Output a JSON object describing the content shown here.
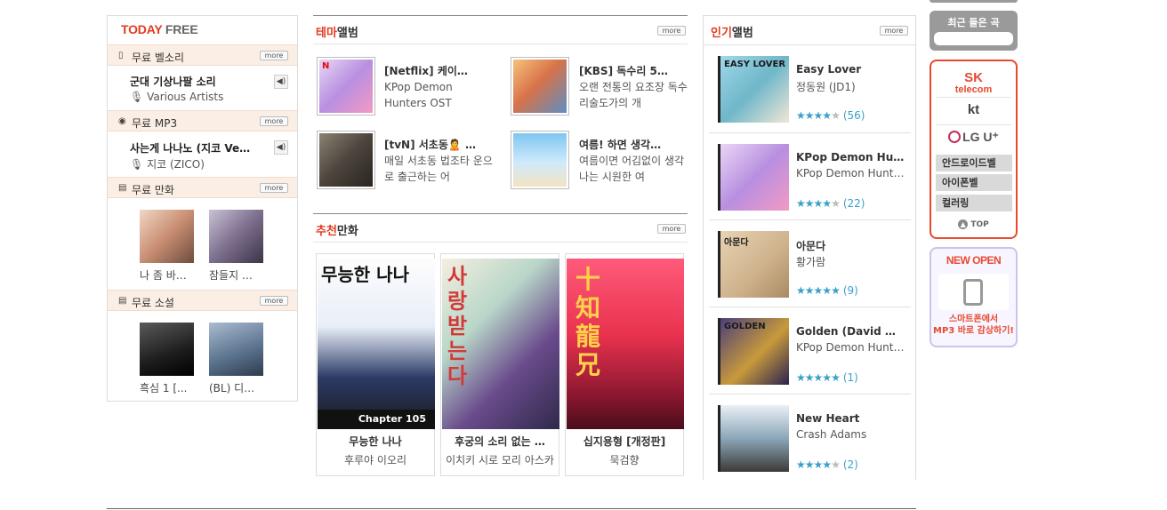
{
  "today_free": {
    "title_red": "TODAY",
    "title_grey": "FREE",
    "more": "more",
    "ringtone": {
      "label": "무료 벨소리",
      "title": "군대 기상나팔 소리",
      "artist": "Various Artists"
    },
    "mp3": {
      "label": "무료 MP3",
      "title": "사는게 나나노 (지코 Ve…",
      "artist": "지코 (ZICO)"
    },
    "comic": {
      "label": "무료 만화",
      "items": [
        {
          "caption": "나 좀 바…"
        },
        {
          "caption": "잠들지 …"
        }
      ]
    },
    "novel": {
      "label": "무료 소설",
      "items": [
        {
          "caption": "흑심 1 [..."
        },
        {
          "caption": "(BL) 디…"
        }
      ]
    }
  },
  "theme_album": {
    "title_red": "테마",
    "title_rest": "앨범",
    "more": "more",
    "items": [
      {
        "title": "[Netflix] 케이…",
        "desc": "KPop Demon Hunters OST"
      },
      {
        "title": "[KBS] 독수리 5…",
        "desc": "오랜 전통의 요조장 독수리술도가의 개"
      },
      {
        "title": "[tvN] 서초동🙎 …",
        "desc": "매일 서초동 법조타 운으로 출근하는 어"
      },
      {
        "title": "여름! 하면 생각…",
        "desc": "여름이면 어김없이 생각나는 시원한 여"
      }
    ]
  },
  "recommended_comic": {
    "title_red": "추천",
    "title_rest": "만화",
    "more": "more",
    "items": [
      {
        "title": "무능한 나나",
        "author": "후루야 이오리",
        "cover_text": "무능한 나나",
        "cover_sub": "Chapter 105"
      },
      {
        "title": "후궁의 소리 없는 …",
        "author": "이치키 시로 모리 아스카",
        "cover_text": "사랑받는다"
      },
      {
        "title": "십지용형 [개정판]",
        "author": "묵검향",
        "cover_text": "十知龍兄"
      }
    ]
  },
  "popular_album": {
    "title_red": "인기",
    "title_rest": "앨범",
    "more": "more",
    "items": [
      {
        "title": "Easy Lover",
        "artist": "정동원 (JD1)",
        "stars": 4,
        "count": "(56)",
        "cover_text": "EASY LOVER"
      },
      {
        "title": "KPop Demon Hu…",
        "artist": "KPop Demon Hunte…",
        "stars": 4,
        "count": "(22)",
        "cover_text": ""
      },
      {
        "title": "아문다",
        "artist": "황가람",
        "stars": 5,
        "count": "(9)",
        "cover_text": "아문다"
      },
      {
        "title": "Golden (David …",
        "artist": "KPop Demon Hunte…",
        "stars": 5,
        "count": "(1)",
        "cover_text": "GOLDEN"
      },
      {
        "title": "New Heart",
        "artist": "Crash Adams",
        "stars": 4,
        "count": "(2)",
        "cover_text": ""
      }
    ]
  },
  "sidebar": {
    "recent_label": "최근 들은 곡",
    "sk_line1": "SK",
    "sk_line2": "telecom",
    "kt": "kt",
    "lg": "LG U⁺",
    "android_bell": "안드로이드벨",
    "iphone_bell": "아이폰벨",
    "coloring": "컬러링",
    "top": "TOP",
    "new_open": "NEW OPEN",
    "promo_line1": "스마트폰에서",
    "promo_line2": "MP3 바로 감상하기!"
  },
  "colors": {
    "accent": "#e03c1f",
    "star": "#3aa0c8",
    "carrier_border": "#e8492e"
  },
  "icons": [
    "phone-icon",
    "disc-icon",
    "book-icon",
    "novel-icon",
    "speaker-icon",
    "mic-icon",
    "star-icon",
    "arrow-up-icon",
    "headphone-icon",
    "netflix-logo"
  ]
}
